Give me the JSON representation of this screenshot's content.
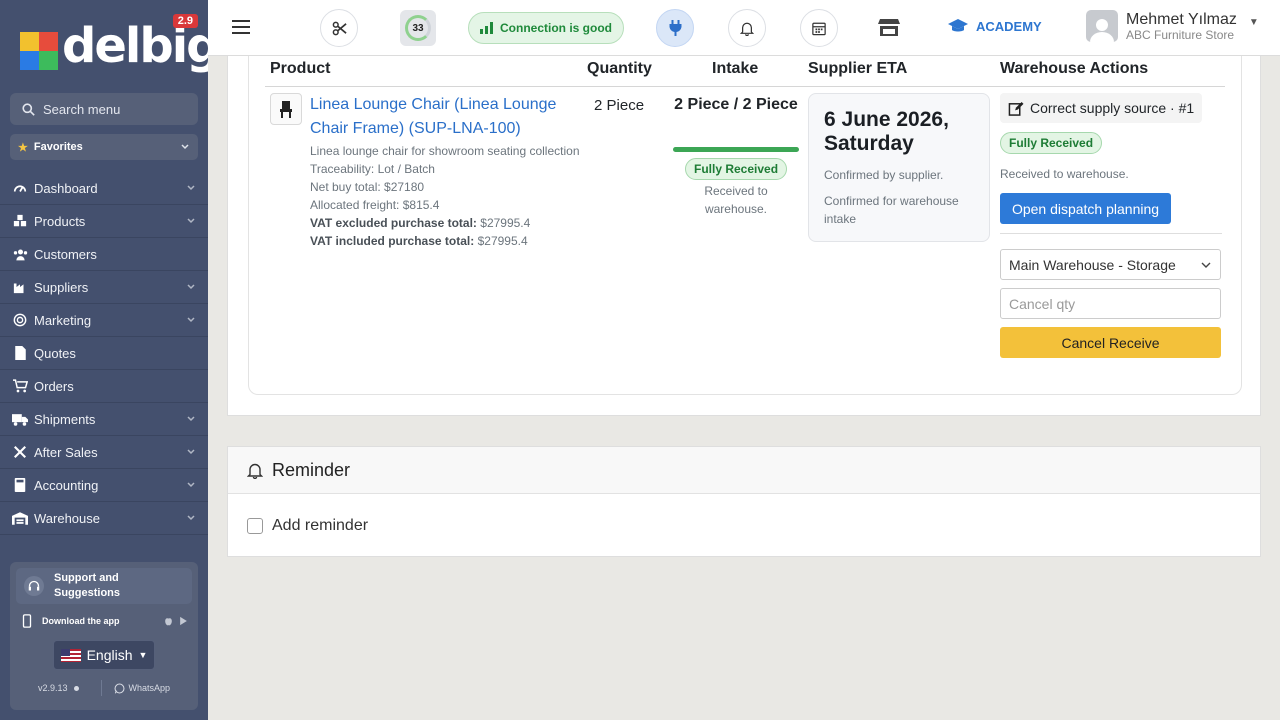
{
  "app": {
    "logo_text": "delbig",
    "version_badge": "2.9"
  },
  "sidebar": {
    "search_placeholder": "Search menu",
    "favorites_label": "Favorites",
    "items": [
      {
        "label": "Dashboard",
        "icon": "gauge-icon",
        "has_children": true
      },
      {
        "label": "Products",
        "icon": "cubes-icon",
        "has_children": true
      },
      {
        "label": "Customers",
        "icon": "users-icon",
        "has_children": false
      },
      {
        "label": "Suppliers",
        "icon": "industry-icon",
        "has_children": true
      },
      {
        "label": "Marketing",
        "icon": "bullseye-icon",
        "has_children": true
      },
      {
        "label": "Quotes",
        "icon": "file-icon",
        "has_children": false
      },
      {
        "label": "Orders",
        "icon": "cart-icon",
        "has_children": false
      },
      {
        "label": "Shipments",
        "icon": "truck-icon",
        "has_children": true
      },
      {
        "label": "After Sales",
        "icon": "tools-icon",
        "has_children": true
      },
      {
        "label": "Accounting",
        "icon": "calculator-icon",
        "has_children": true
      },
      {
        "label": "Warehouse",
        "icon": "warehouse-icon",
        "has_children": true
      }
    ],
    "support": {
      "title": "Support and Suggestions",
      "download_label": "Download the app",
      "language": "English",
      "version": "v2.9.13",
      "whatsapp_label": "WhatsApp"
    }
  },
  "topbar": {
    "counter": "33",
    "connection_status": "Connection is good",
    "academy_label": "ACADEMY",
    "user_name": "Mehmet Yılmaz",
    "user_store": "ABC Furniture Store"
  },
  "table": {
    "headers": {
      "product": "Product",
      "quantity": "Quantity",
      "intake": "Intake",
      "supplier_eta": "Supplier ETA",
      "warehouse_actions": "Warehouse Actions"
    },
    "row": {
      "product_name": "Linea Lounge Chair (Linea Lounge Chair Frame) (SUP-LNA-100)",
      "description": "Linea lounge chair for showroom seating collection",
      "traceability": "Traceability: Lot / Batch",
      "net_buy_total": "Net buy total: $27180",
      "allocated_freight": "Allocated freight: $815.4",
      "vat_excluded_label": "VAT excluded purchase total:",
      "vat_excluded_value": "$27995.4",
      "vat_included_label": "VAT included purchase total:",
      "vat_included_value": "$27995.4",
      "quantity": "2 Piece",
      "intake_value": "2 Piece / 2 Piece",
      "intake_progress": 1.0,
      "intake_status": "Fully Received",
      "intake_note": "Received to warehouse.",
      "eta_date": "6 June 2026, Saturday",
      "eta_confirmed_by": "Confirmed by supplier.",
      "eta_confirmed_for": "Confirmed for warehouse intake",
      "supply_source": "Correct supply source · #1",
      "warehouse_status": "Fully Received",
      "warehouse_note": "Received to warehouse.",
      "dispatch_button": "Open dispatch planning",
      "warehouse_select": "Main Warehouse - Storage",
      "cancel_qty_placeholder": "Cancel qty",
      "cancel_receive_button": "Cancel Receive"
    }
  },
  "reminder": {
    "title": "Reminder",
    "checkbox_label": "Add reminder"
  },
  "colors": {
    "sidebar_bg": "#44506e",
    "primary": "#2d7ad8",
    "warning": "#f3c13a",
    "success": "#1e7c35"
  }
}
